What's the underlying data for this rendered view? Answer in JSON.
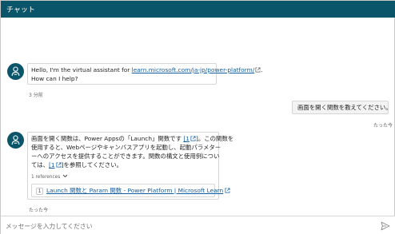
{
  "header": {
    "title": "チャット"
  },
  "messages": {
    "bot1": {
      "line1_prefix": "Hello, I'm the virtual assistant for ",
      "line1_link": "learn.microsoft.com/ja-jp/power-platform/",
      "line2": "How can I help?",
      "time": "3 分前"
    },
    "user1": {
      "text": "画面を開く関数を教えてください。",
      "time": "たった今"
    },
    "bot2": {
      "l1a": "画面を開く関数は、Power Appsの「Launch」関数です ",
      "l1cite": "[1",
      "l1b": "]。この関数を",
      "l2": "使用すると、Webページやキャンバスアプリを起動し、起動パラメター",
      "l3": "ーへのアクセスを提供することができます。関数の構文と使用例につい",
      "l4a": "ては、",
      "l4cite": "[1",
      "l4b": "]を参照してください。",
      "refs_label": "1 references",
      "ref": {
        "num": "1",
        "title": "Launch 関数と Param 関数 - Power Platform | Microsoft Learn"
      },
      "time": "たった今"
    }
  },
  "composer": {
    "placeholder": "メッセージを入力してください"
  },
  "icons": {
    "avatar": "bot-person-icon",
    "external": "external-link-icon",
    "chevron": "chevron-down-icon",
    "send": "send-icon"
  },
  "colors": {
    "header": "#0b556a",
    "link": "#115ea3"
  }
}
